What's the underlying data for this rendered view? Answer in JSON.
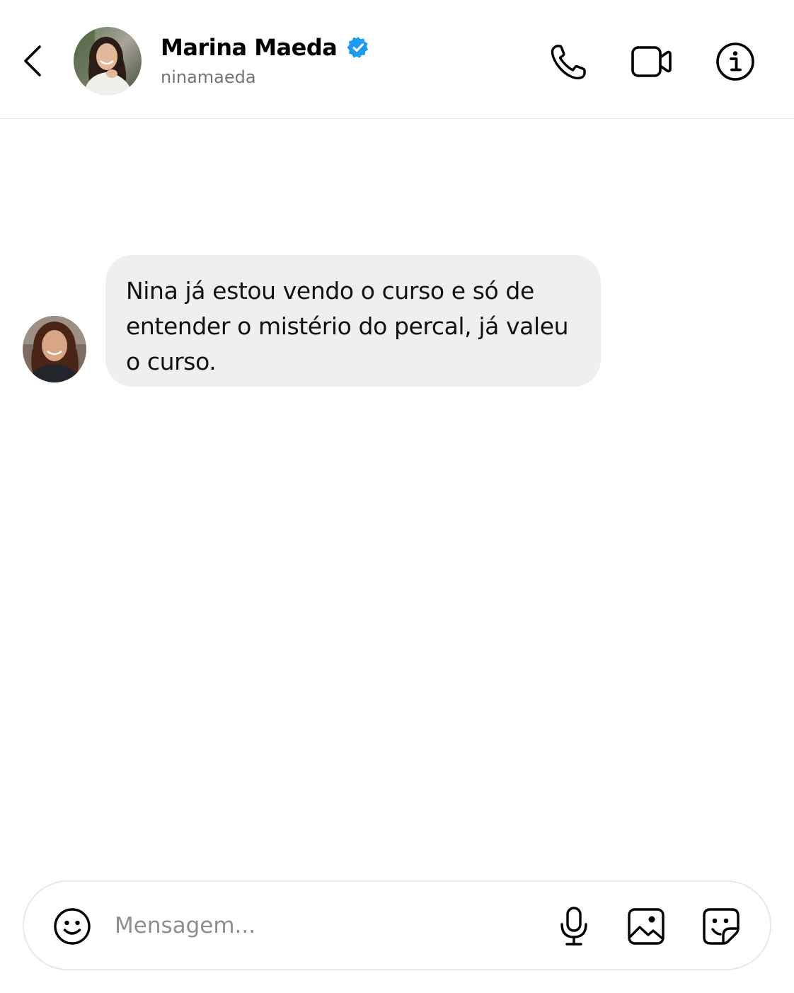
{
  "header": {
    "display_name": "Marina Maeda",
    "username": "ninamaeda",
    "verified_color": "#1d9bf0",
    "icons": {
      "back": "chevron-left-icon",
      "call": "phone-icon",
      "video": "video-camera-icon",
      "info": "info-icon"
    }
  },
  "conversation": {
    "messages": [
      {
        "direction": "incoming",
        "text": "Nina já estou vendo o curso e só de entender o mistério do percal, já valeu o curso."
      }
    ]
  },
  "composer": {
    "placeholder": "Mensagem...",
    "value": "",
    "icons": {
      "emoji": "smiley-icon",
      "mic": "microphone-icon",
      "gallery": "image-icon",
      "sticker": "sticker-icon"
    }
  },
  "colors": {
    "bubble_incoming": "#efeff1",
    "divider": "#e6e6e6",
    "secondary_text": "#737373"
  }
}
